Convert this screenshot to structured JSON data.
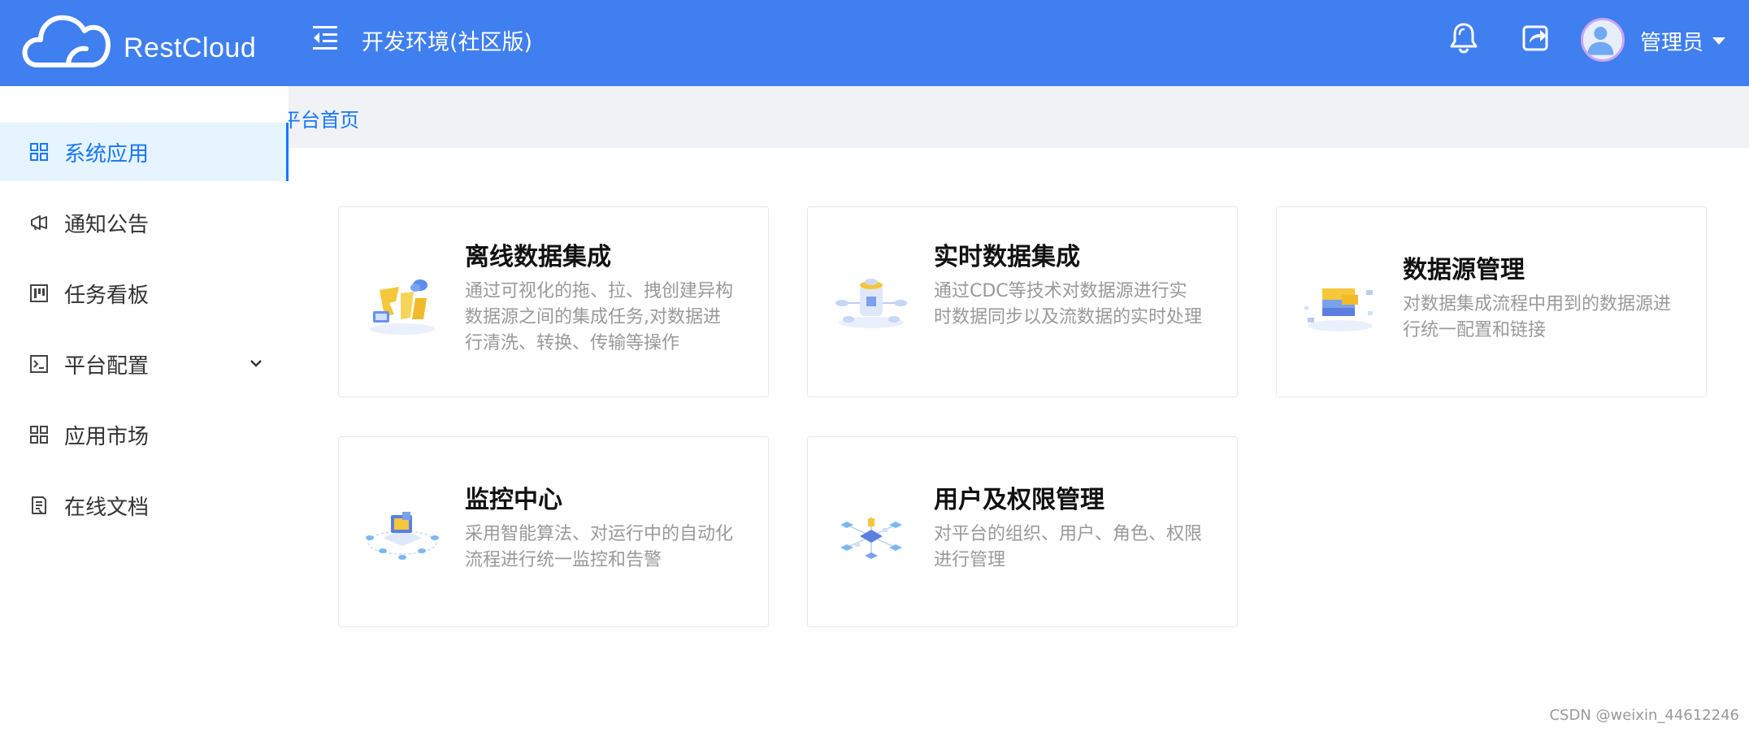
{
  "brand": {
    "name": "RestCloud"
  },
  "header": {
    "environment_title": "开发环境(社区版)",
    "user_name": "管理员"
  },
  "sidebar": {
    "items": [
      {
        "label": "系统应用",
        "icon": "grid-icon",
        "active": true
      },
      {
        "label": "通知公告",
        "icon": "megaphone-icon"
      },
      {
        "label": "任务看板",
        "icon": "kanban-icon"
      },
      {
        "label": "平台配置",
        "icon": "terminal-icon",
        "has_submenu": true
      },
      {
        "label": "应用市场",
        "icon": "grid-icon"
      },
      {
        "label": "在线文档",
        "icon": "document-icon"
      }
    ]
  },
  "breadcrumb": {
    "text": "平台首页"
  },
  "cards": [
    {
      "title": "离线数据集成",
      "description": "通过可视化的拖、拉、拽创建异构数据源之间的集成任务,对数据进行清洗、转换、传输等操作"
    },
    {
      "title": "实时数据集成",
      "description": "通过CDC等技术对数据源进行实时数据同步以及流数据的实时处理"
    },
    {
      "title": "数据源管理",
      "description": "对数据集成流程中用到的数据源进行统一配置和链接"
    },
    {
      "title": "监控中心",
      "description": "采用智能算法、对运行中的自动化流程进行统一监控和告警"
    },
    {
      "title": "用户及权限管理",
      "description": "对平台的组织、用户、角色、权限进行管理"
    }
  ],
  "watermark": "CSDN @weixin_44612246",
  "colors": {
    "header": "#3f7ff0",
    "accent": "#1677ff",
    "active_bg": "#e6f4ff"
  }
}
